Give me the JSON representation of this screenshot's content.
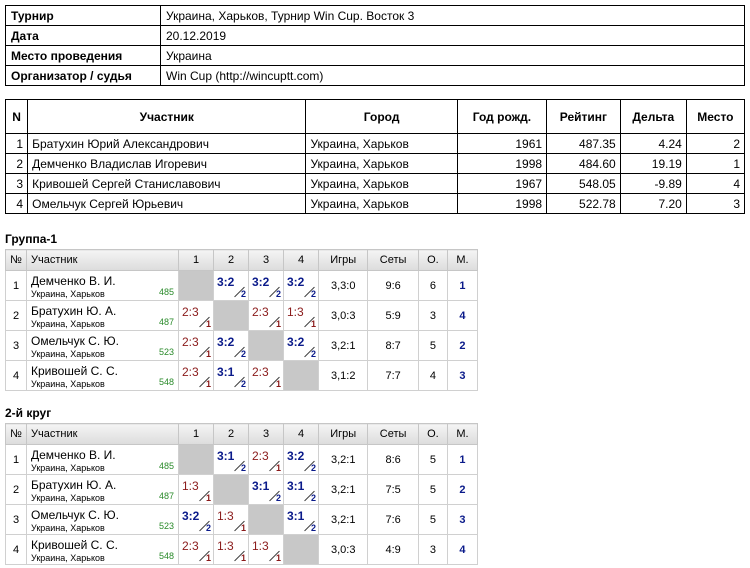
{
  "info": [
    {
      "label": "Турнир",
      "value": "Украина, Харьков, Турнир Win Cup. Восток 3"
    },
    {
      "label": "Дата",
      "value": "20.12.2019"
    },
    {
      "label": "Место проведения",
      "value": "Украина"
    },
    {
      "label": "Организатор / судья",
      "value": "Win Cup (http://wincuptt.com)"
    }
  ],
  "participants": {
    "headers": [
      "N",
      "Участник",
      "Город",
      "Год рожд.",
      "Рейтинг",
      "Дельта",
      "Место"
    ],
    "rows": [
      [
        "1",
        "Братухин Юрий Александрович",
        "Украина, Харьков",
        "1961",
        "487.35",
        "4.24",
        "2"
      ],
      [
        "2",
        "Демченко Владислав Игоревич",
        "Украина, Харьков",
        "1998",
        "484.60",
        "19.19",
        "1"
      ],
      [
        "3",
        "Кривошей Сергей Станиславович",
        "Украина, Харьков",
        "1967",
        "548.05",
        "-9.89",
        "4"
      ],
      [
        "4",
        "Омельчук Сергей Юрьевич",
        "Украина, Харьков",
        "1998",
        "522.78",
        "7.20",
        "3"
      ]
    ]
  },
  "groups": [
    {
      "title": "Группа-1",
      "headers": [
        "№",
        "Участник",
        "1",
        "2",
        "3",
        "4",
        "Игры",
        "Сеты",
        "О.",
        "М."
      ],
      "rows": [
        {
          "n": "1",
          "name": "Демченко В. И.",
          "city": "Украина, Харьков",
          "rating": "485",
          "cells": [
            null,
            {
              "s": "3:2",
              "p": "2",
              "w": true
            },
            {
              "s": "3:2",
              "p": "2",
              "w": true
            },
            {
              "s": "3:2",
              "p": "2",
              "w": true
            }
          ],
          "games": "3,3:0",
          "sets": "9:6",
          "points": "6",
          "place": "1"
        },
        {
          "n": "2",
          "name": "Братухин Ю. А.",
          "city": "Украина, Харьков",
          "rating": "487",
          "cells": [
            {
              "s": "2:3",
              "p": "1",
              "w": false
            },
            null,
            {
              "s": "2:3",
              "p": "1",
              "w": false
            },
            {
              "s": "1:3",
              "p": "1",
              "w": false
            }
          ],
          "games": "3,0:3",
          "sets": "5:9",
          "points": "3",
          "place": "4"
        },
        {
          "n": "3",
          "name": "Омельчук С. Ю.",
          "city": "Украина, Харьков",
          "rating": "523",
          "cells": [
            {
              "s": "2:3",
              "p": "1",
              "w": false
            },
            {
              "s": "3:2",
              "p": "2",
              "w": true
            },
            null,
            {
              "s": "3:2",
              "p": "2",
              "w": true
            }
          ],
          "games": "3,2:1",
          "sets": "8:7",
          "points": "5",
          "place": "2"
        },
        {
          "n": "4",
          "name": "Кривошей С. С.",
          "city": "Украина, Харьков",
          "rating": "548",
          "cells": [
            {
              "s": "2:3",
              "p": "1",
              "w": false
            },
            {
              "s": "3:1",
              "p": "2",
              "w": true
            },
            {
              "s": "2:3",
              "p": "1",
              "w": false
            },
            null
          ],
          "games": "3,1:2",
          "sets": "7:7",
          "points": "4",
          "place": "3"
        }
      ]
    },
    {
      "title": "2-й круг",
      "headers": [
        "№",
        "Участник",
        "1",
        "2",
        "3",
        "4",
        "Игры",
        "Сеты",
        "О.",
        "М."
      ],
      "rows": [
        {
          "n": "1",
          "name": "Демченко В. И.",
          "city": "Украина, Харьков",
          "rating": "485",
          "cells": [
            null,
            {
              "s": "3:1",
              "p": "2",
              "w": true
            },
            {
              "s": "2:3",
              "p": "1",
              "w": false
            },
            {
              "s": "3:2",
              "p": "2",
              "w": true
            }
          ],
          "games": "3,2:1",
          "sets": "8:6",
          "points": "5",
          "place": "1"
        },
        {
          "n": "2",
          "name": "Братухин Ю. А.",
          "city": "Украина, Харьков",
          "rating": "487",
          "cells": [
            {
              "s": "1:3",
              "p": "1",
              "w": false
            },
            null,
            {
              "s": "3:1",
              "p": "2",
              "w": true
            },
            {
              "s": "3:1",
              "p": "2",
              "w": true
            }
          ],
          "games": "3,2:1",
          "sets": "7:5",
          "points": "5",
          "place": "2"
        },
        {
          "n": "3",
          "name": "Омельчук С. Ю.",
          "city": "Украина, Харьков",
          "rating": "523",
          "cells": [
            {
              "s": "3:2",
              "p": "2",
              "w": true
            },
            {
              "s": "1:3",
              "p": "1",
              "w": false
            },
            null,
            {
              "s": "3:1",
              "p": "2",
              "w": true
            }
          ],
          "games": "3,2:1",
          "sets": "7:6",
          "points": "5",
          "place": "3"
        },
        {
          "n": "4",
          "name": "Кривошей С. С.",
          "city": "Украина, Харьков",
          "rating": "548",
          "cells": [
            {
              "s": "2:3",
              "p": "1",
              "w": false
            },
            {
              "s": "1:3",
              "p": "1",
              "w": false
            },
            {
              "s": "1:3",
              "p": "1",
              "w": false
            },
            null
          ],
          "games": "3,0:3",
          "sets": "4:9",
          "points": "3",
          "place": "4"
        }
      ]
    }
  ]
}
